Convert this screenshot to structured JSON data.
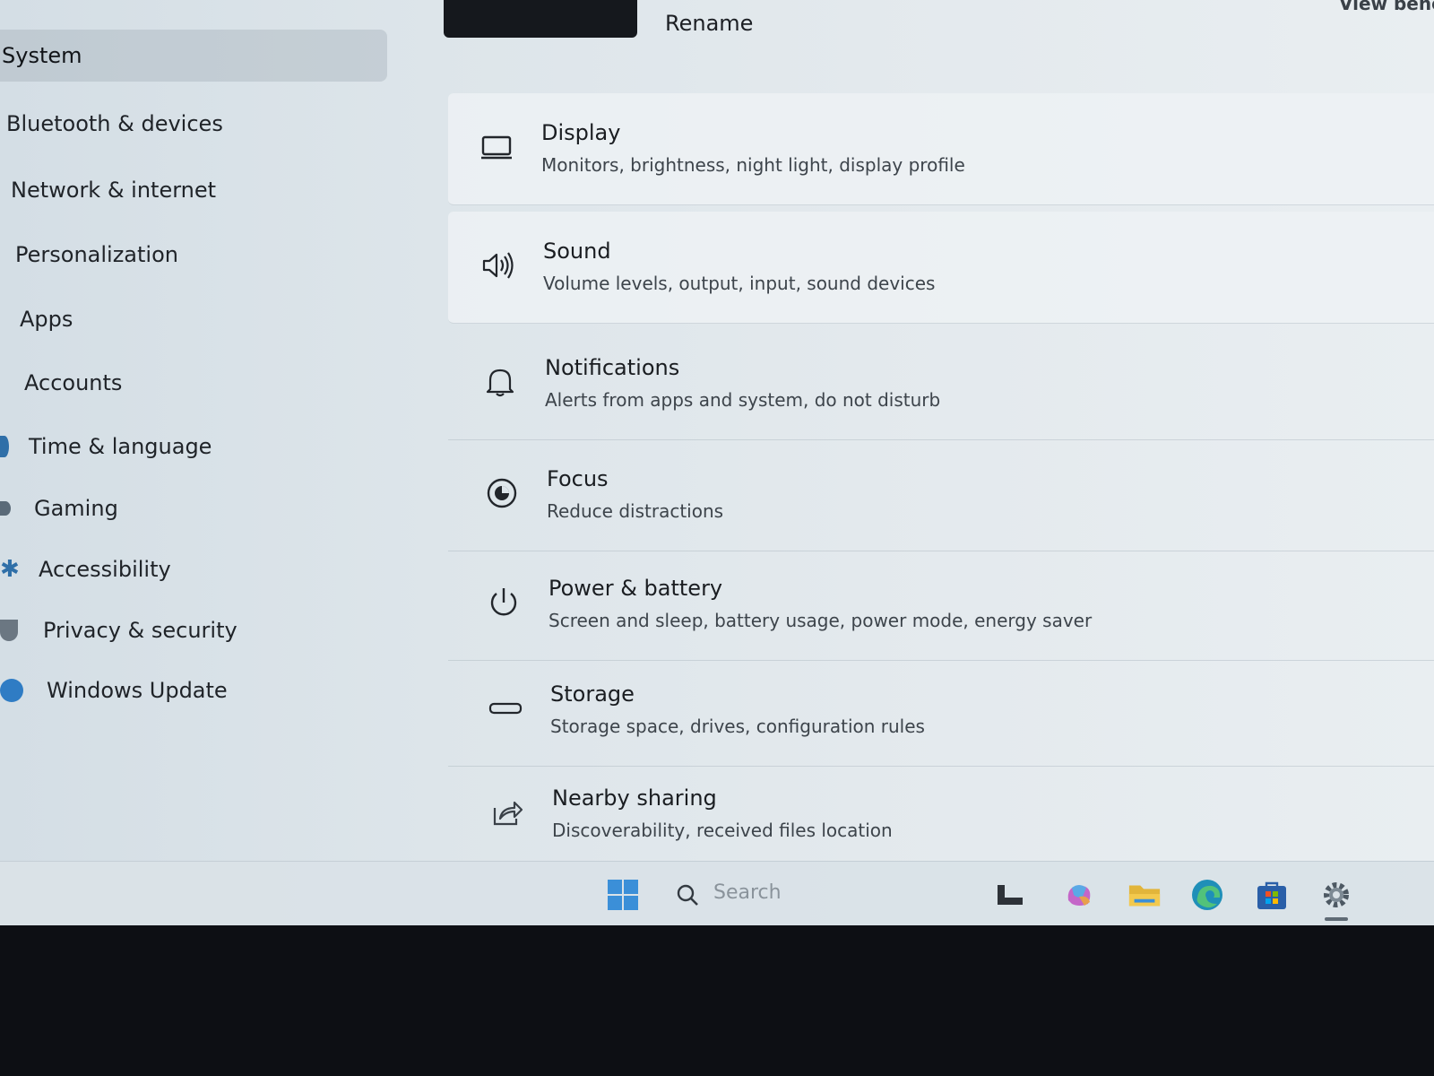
{
  "header": {
    "rename_label": "Rename",
    "view_benefits_label": "View bene"
  },
  "sidebar": {
    "items": [
      {
        "label": "System",
        "selected": true
      },
      {
        "label": "Bluetooth & devices"
      },
      {
        "label": "Network & internet"
      },
      {
        "label": "Personalization"
      },
      {
        "label": "Apps"
      },
      {
        "label": "Accounts"
      },
      {
        "label": "Time & language"
      },
      {
        "label": "Gaming"
      },
      {
        "label": "Accessibility"
      },
      {
        "label": "Privacy & security"
      },
      {
        "label": "Windows Update"
      }
    ]
  },
  "settings": [
    {
      "icon": "display-icon",
      "title": "Display",
      "desc": "Monitors, brightness, night light, display profile"
    },
    {
      "icon": "speaker-icon",
      "title": "Sound",
      "desc": "Volume levels, output, input, sound devices"
    },
    {
      "icon": "bell-icon",
      "title": "Notifications",
      "desc": "Alerts from apps and system, do not disturb"
    },
    {
      "icon": "focus-icon",
      "title": "Focus",
      "desc": "Reduce distractions"
    },
    {
      "icon": "power-icon",
      "title": "Power & battery",
      "desc": "Screen and sleep, battery usage, power mode, energy saver"
    },
    {
      "icon": "storage-icon",
      "title": "Storage",
      "desc": "Storage space, drives, configuration rules"
    },
    {
      "icon": "share-icon",
      "title": "Nearby sharing",
      "desc": "Discoverability, received files location"
    }
  ],
  "taskbar": {
    "search_placeholder": "Search",
    "icons": [
      "windows-start-icon",
      "search-icon",
      "widgets-icon",
      "copilot-icon",
      "file-explorer-icon",
      "edge-browser-icon",
      "microsoft-store-icon",
      "settings-gear-icon"
    ]
  },
  "colors": {
    "accent": "#2f6fa8",
    "screen_bg": "#dde5ea",
    "taskbar_bg": "#dae2e7",
    "bezel": "#0d0f14"
  }
}
